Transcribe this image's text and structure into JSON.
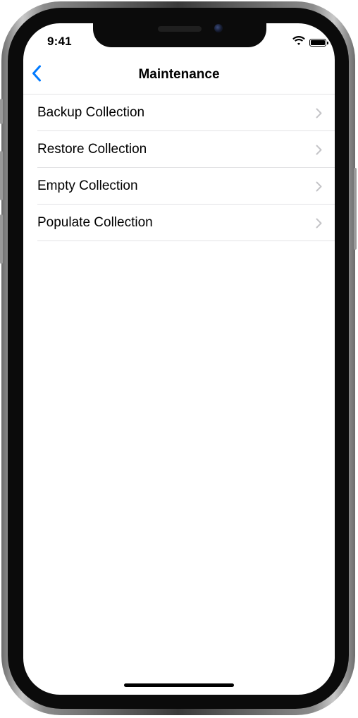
{
  "status_bar": {
    "time": "9:41",
    "icons": [
      "wifi-icon",
      "battery-icon"
    ]
  },
  "navbar": {
    "title": "Maintenance",
    "back_icon": "chevron-left-icon"
  },
  "list": {
    "items": [
      {
        "label": "Backup Collection"
      },
      {
        "label": "Restore Collection"
      },
      {
        "label": "Empty Collection"
      },
      {
        "label": "Populate Collection"
      }
    ],
    "accessory_icon": "chevron-right-icon"
  },
  "colors": {
    "accent": "#007aff",
    "separator": "#e3e3e5",
    "chevron": "#c4c4c7",
    "text": "#000000"
  }
}
